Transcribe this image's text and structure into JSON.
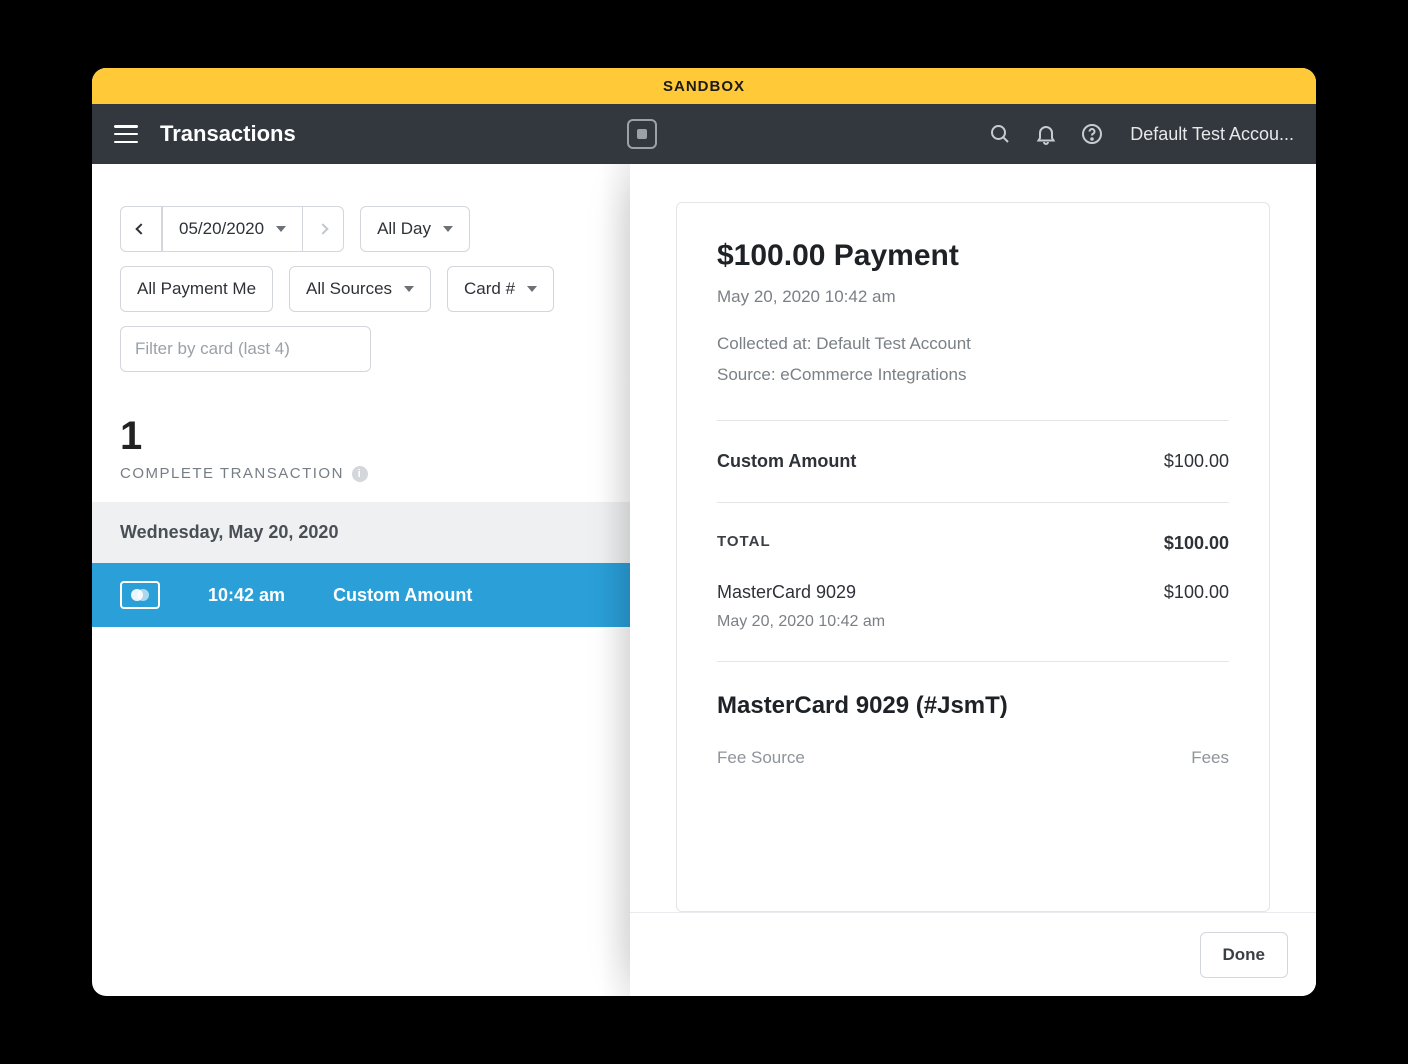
{
  "sandbox_label": "SANDBOX",
  "topbar": {
    "title": "Transactions",
    "account_label": "Default Test Accou..."
  },
  "filters": {
    "date": "05/20/2020",
    "time": "All Day",
    "payment_methods": "All Payment Me",
    "sources": "All Sources",
    "card_number": "Card #",
    "card_filter_placeholder": "Filter by card (last 4)"
  },
  "summary": {
    "count": "1",
    "label": "COMPLETE TRANSACTION"
  },
  "list": {
    "day_header": "Wednesday, May 20, 2020",
    "rows": [
      {
        "time": "10:42 am",
        "desc": "Custom Amount"
      }
    ]
  },
  "detail": {
    "title": "$100.00 Payment",
    "timestamp": "May 20, 2020 10:42 am",
    "collected_at": "Collected at: Default Test Account",
    "source": "Source: eCommerce Integrations",
    "item_label": "Custom Amount",
    "item_amount": "$100.00",
    "total_label": "TOTAL",
    "total_amount": "$100.00",
    "tender_label": "MasterCard 9029",
    "tender_amount": "$100.00",
    "tender_time": "May 20, 2020 10:42 am",
    "card_section": "MasterCard 9029 (#JsmT)",
    "fee_source_label": "Fee Source",
    "fee_source_value": "Fees",
    "done": "Done"
  }
}
